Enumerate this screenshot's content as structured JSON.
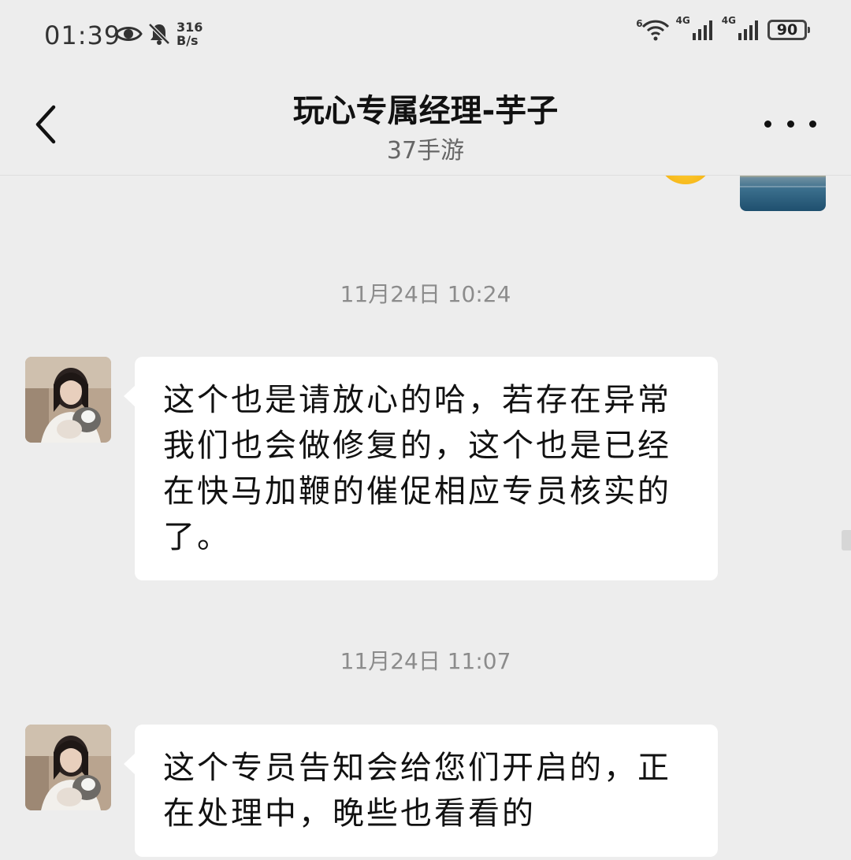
{
  "status_bar": {
    "time": "01:39",
    "net_speed_value": "316",
    "net_speed_unit": "B/s",
    "network_1": "4G",
    "network_2": "4G",
    "wifi_label": "6",
    "battery": "90"
  },
  "header": {
    "title": "玩心专属经理-芋子",
    "subtitle": "37手游"
  },
  "messages": [
    {
      "timestamp": "11月24日 10:24",
      "text": "这个也是请放心的哈，若存在异常我们也会做修复的，这个也是已经在快马加鞭的催促相应专员核实的了。"
    },
    {
      "timestamp": "11月24日 11:07",
      "text": "这个专员告知会给您们开启的，正在处理中，晚些也看看的"
    }
  ],
  "icons": {
    "back": "chevron-left-icon",
    "more": "more-dots-icon",
    "eye": "eye-icon",
    "bell": "bell-off-icon",
    "wifi": "wifi-icon",
    "signal": "signal-icon",
    "battery": "battery-icon"
  },
  "colors": {
    "background": "#ededed",
    "bubble": "#ffffff",
    "timestamp": "#8c8c8c",
    "text": "#111111"
  }
}
